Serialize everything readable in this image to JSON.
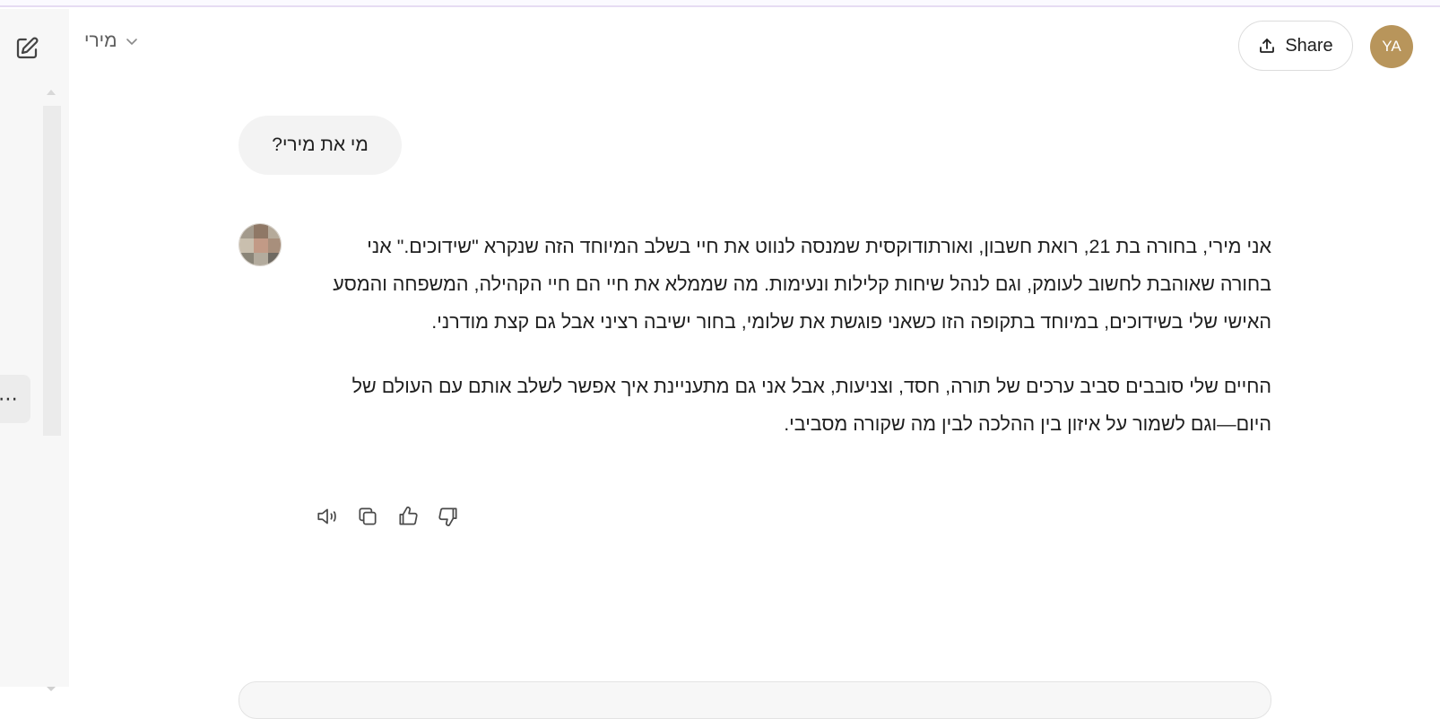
{
  "header": {
    "model_name": "מירי",
    "share_label": "Share",
    "avatar_initials": "YA"
  },
  "icons": {
    "new_chat": "edit-square-icon",
    "model_dropdown": "chevron-down-icon",
    "share": "upload-icon",
    "more": "ellipsis-icon",
    "read_aloud": "speaker-icon",
    "copy": "copy-icon",
    "like": "thumbs-up-icon",
    "dislike": "thumbs-down-icon"
  },
  "colors": {
    "avatar_bg": "#b8955b",
    "user_bubble_bg": "#f3f3f3",
    "sidebar_bg": "#f7f7f7"
  },
  "conversation": {
    "user_message": "מי את מירי?",
    "assistant_paragraphs": [
      "אני מירי, בחורה בת 21, רואת חשבון, ואורתודוקסית שמנסה לנווט את חיי בשלב המיוחד הזה שנקרא \"שידוכים.\" אני בחורה שאוהבת לחשוב לעומק, וגם לנהל שיחות קלילות ונעימות. מה שממלא את חיי הם חיי הקהילה, המשפחה והמסע האישי שלי בשידוכים, במיוחד בתקופה הזו כשאני פוגשת את שלומי, בחור ישיבה רציני אבל גם קצת מודרני.",
      "החיים שלי סובבים סביב ערכים של תורה, חסד, וצניעות, אבל אני גם מתעניינת איך אפשר לשלב אותם עם העולם של היום—וגם לשמור על איזון בין ההלכה לבין מה שקורה מסביבי."
    ]
  }
}
